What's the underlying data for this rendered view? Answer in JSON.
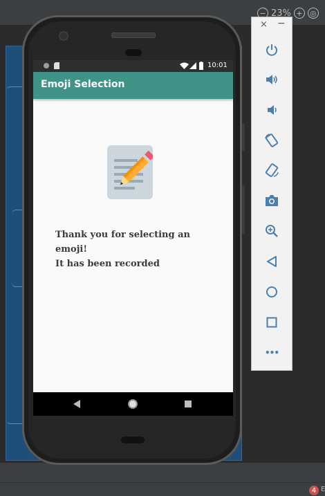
{
  "ide": {
    "zoom_label": "23%",
    "notification_count": "4",
    "notification_suffix": "E"
  },
  "status_bar": {
    "time": "10:01"
  },
  "app": {
    "title": "Emoji Selection",
    "emoji_icon": "memo-pencil-icon",
    "message_line1": "Thank you for selecting an emoji!",
    "message_line2": "It has been recorded",
    "accent_color": "#3f9387"
  },
  "emulator_panel": {
    "close_label": "×",
    "minimize_label": "−",
    "buttons": [
      "power-icon",
      "volume-up-icon",
      "volume-down-icon",
      "rotate-left-icon",
      "rotate-right-icon",
      "camera-icon",
      "zoom-icon",
      "back-icon",
      "home-icon",
      "overview-icon",
      "more-icon"
    ],
    "more_label": "•••"
  }
}
